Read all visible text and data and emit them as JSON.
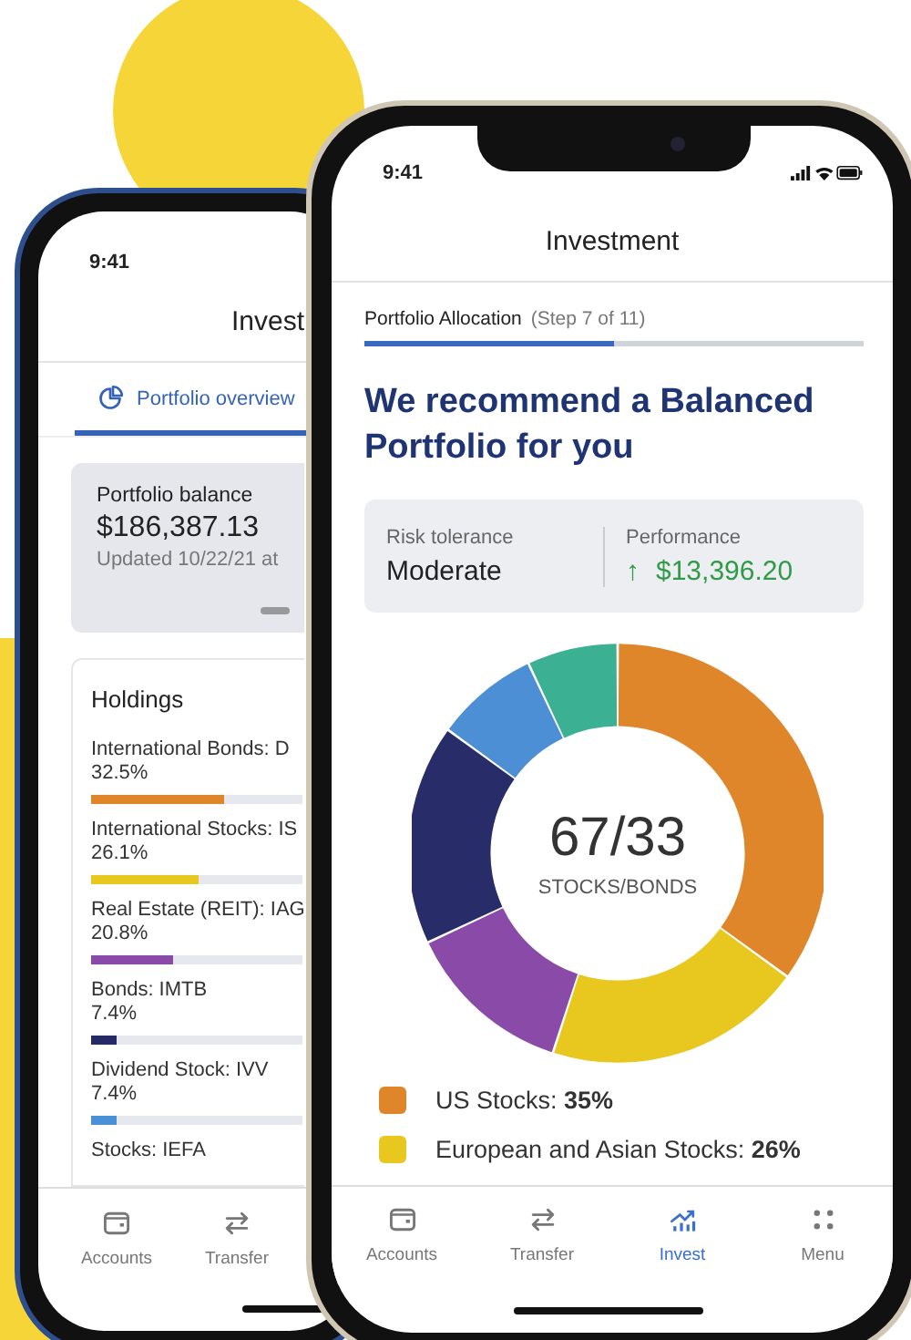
{
  "back_phone": {
    "status_time": "9:41",
    "title": "Invest",
    "tab": {
      "label": "Portfolio overview",
      "selected": true
    },
    "balance": {
      "label": "Portfolio balance",
      "amount": "$186,387.13",
      "updated": "Updated 10/22/21 at"
    },
    "holdings": {
      "title": "Holdings",
      "items": [
        {
          "name": "International Bonds: D",
          "percent": "32.5%",
          "level": 0.63,
          "color": "#e0862a"
        },
        {
          "name": "International Stocks: IS",
          "percent": "26.1%",
          "level": 0.51,
          "color": "#e8c81e"
        },
        {
          "name": "Real Estate (REIT): IAG",
          "percent": "20.8%",
          "level": 0.39,
          "color": "#8a4aa8"
        },
        {
          "name": "Bonds: IMTB",
          "percent": "7.4%",
          "level": 0.12,
          "color": "#252a66"
        },
        {
          "name": "Dividend Stock: IVV",
          "percent": "7.4%",
          "level": 0.12,
          "color": "#4a90d6"
        },
        {
          "name": "Stocks: IEFA"
        }
      ]
    },
    "nav": [
      {
        "label": "Accounts",
        "kind": "wallet",
        "selected": false
      },
      {
        "label": "Transfer",
        "kind": "transfer",
        "selected": false
      }
    ]
  },
  "front_phone": {
    "status_time": "9:41",
    "title": "Investment",
    "step": {
      "label": "Portfolio Allocation",
      "count": "(Step 7 of 11)",
      "level": 0.5
    },
    "heading": "We recommend a Balanced Portfolio for you",
    "risk": {
      "label": "Risk tolerance",
      "value": "Moderate"
    },
    "performance": {
      "label": "Performance",
      "arrow": "↑",
      "value": "$13,396.20"
    },
    "donut": {
      "center_value": "67/33",
      "center_label": "STOCKS/BONDS"
    },
    "legend": [
      {
        "label": "US Stocks: **35%**",
        "color": "#e0862a"
      },
      {
        "label": "European and Asian Stocks: **26%**",
        "color": "#e8c81e"
      }
    ],
    "nav": [
      {
        "label": "Accounts",
        "kind": "wallet",
        "selected": false
      },
      {
        "label": "Transfer",
        "kind": "transfer",
        "selected": false
      },
      {
        "label": "Invest",
        "kind": "invest",
        "selected": true
      },
      {
        "label": "Menu",
        "kind": "menu",
        "selected": false
      }
    ]
  }
}
